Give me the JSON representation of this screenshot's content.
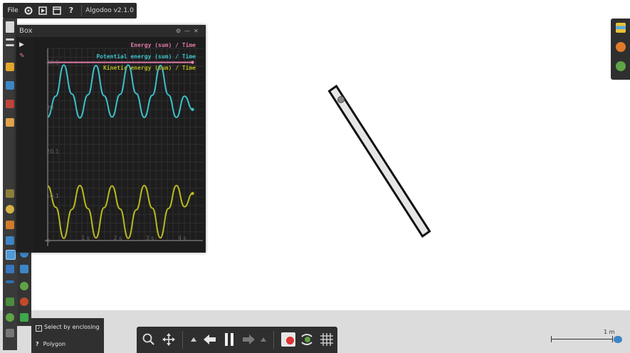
{
  "menu": {
    "file_label": "File",
    "help_label": "?",
    "app_name": "Algodoo v2.1.0"
  },
  "graph_window": {
    "title": "Box",
    "legend": [
      {
        "label": "Energy (sum) / Time",
        "color": "#e07aa8"
      },
      {
        "label": "Potential energy (sum) / Time",
        "color": "#3cc0cc"
      },
      {
        "label": "Kinetic energy (sum) / Time",
        "color": "#b9b91e"
      }
    ],
    "y_tick_labels": [
      "40.1",
      "30",
      "20.1",
      "10.1",
      "0"
    ],
    "x_tick_labels": [
      "1 s",
      "2 s",
      "3 s",
      "4 s"
    ]
  },
  "chart_data": {
    "type": "line",
    "x": [
      0.0,
      0.25,
      0.5,
      0.75,
      1.0,
      1.25,
      1.5,
      1.75,
      2.0,
      2.25,
      2.5,
      2.75,
      3.0,
      3.25,
      3.5,
      3.75,
      4.0,
      4.25,
      4.5
    ],
    "series": [
      {
        "name": "Energy (sum) / Time",
        "color": "#e07aa8",
        "values": [
          40.1,
          40.1,
          40.1,
          40.1,
          40.1,
          40.1,
          40.1,
          40.1,
          40.1,
          40.1,
          40.1,
          40.1,
          40.1,
          40.1,
          40.1,
          40.1,
          40.1,
          40.1,
          40.1
        ]
      },
      {
        "name": "Potential energy (sum) / Time",
        "color": "#3cc0cc",
        "values": [
          27.8,
          32.5,
          39.5,
          33.0,
          27.6,
          32.8,
          39.4,
          32.6,
          27.8,
          32.9,
          39.5,
          33.1,
          27.7,
          32.7,
          39.4,
          32.8,
          27.7,
          32.5,
          29.5
        ]
      },
      {
        "name": "Kinetic energy (sum) / Time",
        "color": "#b9b91e",
        "values": [
          12.3,
          7.5,
          0.5,
          7.0,
          12.4,
          7.2,
          0.6,
          7.4,
          12.3,
          7.1,
          0.5,
          6.9,
          12.4,
          7.3,
          0.6,
          7.2,
          12.4,
          7.6,
          10.6
        ]
      }
    ],
    "ylim": [
      0,
      41
    ],
    "xlim": [
      0,
      4.6
    ],
    "grid": true,
    "legend_position": "top-right"
  },
  "toolbar_left": {
    "icons": [
      "new-scene-icon",
      "menu-icon",
      "open-folder-icon",
      "save-icon",
      "scene-icon",
      "settings-icon"
    ]
  },
  "right_panel": {
    "icons": [
      "layers-icon",
      "palette-icon",
      "zoom-world-icon"
    ]
  },
  "select_options": {
    "enclosing_label": "Select by enclosing",
    "help_mark": "?",
    "shape_label": "Polygon"
  },
  "bottom_toolbar": {
    "icons": [
      "zoom-icon",
      "move-icon",
      "step-down-icon",
      "undo-icon",
      "pause-icon",
      "redo-icon",
      "step-up-icon",
      "record-icon",
      "gravity-icon",
      "grid-icon"
    ]
  },
  "scale": {
    "label": "1 m"
  },
  "colors": {
    "panel_bg": "#2b2b2b",
    "ground": "#dcdcdc",
    "plank_fill": "#e6e6e6",
    "plank_stroke": "#111111"
  }
}
